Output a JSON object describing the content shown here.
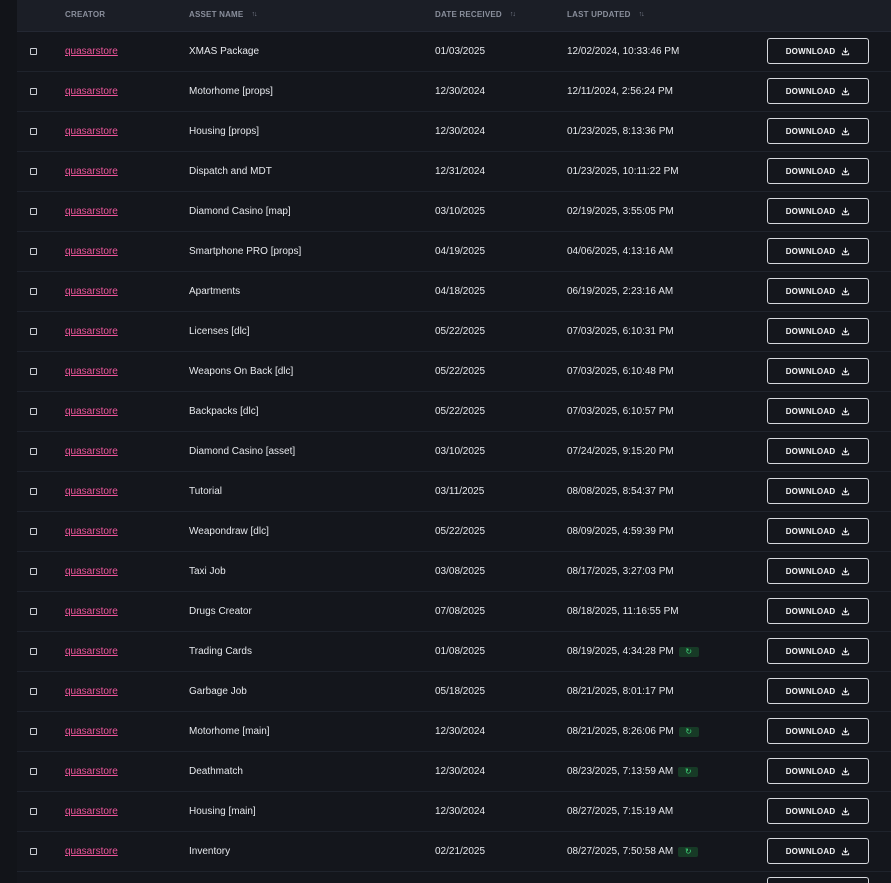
{
  "table": {
    "headers": {
      "creator": "CREATOR",
      "asset_name": "ASSET NAME",
      "date_received": "DATE RECEIVED",
      "last_updated": "LAST UPDATED"
    },
    "sort_icon": "sort-arrows-icon",
    "download_label": "DOWNLOAD",
    "download_icon": "download-icon",
    "update_badge_icon": "refresh-icon",
    "rows": [
      {
        "creator": "quasarstore",
        "asset": "XMAS Package",
        "received": "01/03/2025",
        "updated": "12/02/2024, 10:33:46 PM",
        "badge": false
      },
      {
        "creator": "quasarstore",
        "asset": "Motorhome [props]",
        "received": "12/30/2024",
        "updated": "12/11/2024, 2:56:24 PM",
        "badge": false
      },
      {
        "creator": "quasarstore",
        "asset": "Housing [props]",
        "received": "12/30/2024",
        "updated": "01/23/2025, 8:13:36 PM",
        "badge": false
      },
      {
        "creator": "quasarstore",
        "asset": "Dispatch and MDT",
        "received": "12/31/2024",
        "updated": "01/23/2025, 10:11:22 PM",
        "badge": false
      },
      {
        "creator": "quasarstore",
        "asset": "Diamond Casino [map]",
        "received": "03/10/2025",
        "updated": "02/19/2025, 3:55:05 PM",
        "badge": false
      },
      {
        "creator": "quasarstore",
        "asset": "Smartphone PRO [props]",
        "received": "04/19/2025",
        "updated": "04/06/2025, 4:13:16 AM",
        "badge": false
      },
      {
        "creator": "quasarstore",
        "asset": "Apartments",
        "received": "04/18/2025",
        "updated": "06/19/2025, 2:23:16 AM",
        "badge": false
      },
      {
        "creator": "quasarstore",
        "asset": "Licenses [dlc]",
        "received": "05/22/2025",
        "updated": "07/03/2025, 6:10:31 PM",
        "badge": false
      },
      {
        "creator": "quasarstore",
        "asset": "Weapons On Back [dlc]",
        "received": "05/22/2025",
        "updated": "07/03/2025, 6:10:48 PM",
        "badge": false
      },
      {
        "creator": "quasarstore",
        "asset": "Backpacks [dlc]",
        "received": "05/22/2025",
        "updated": "07/03/2025, 6:10:57 PM",
        "badge": false
      },
      {
        "creator": "quasarstore",
        "asset": "Diamond Casino [asset]",
        "received": "03/10/2025",
        "updated": "07/24/2025, 9:15:20 PM",
        "badge": false
      },
      {
        "creator": "quasarstore",
        "asset": "Tutorial",
        "received": "03/11/2025",
        "updated": "08/08/2025, 8:54:37 PM",
        "badge": false
      },
      {
        "creator": "quasarstore",
        "asset": "Weapondraw [dlc]",
        "received": "05/22/2025",
        "updated": "08/09/2025, 4:59:39 PM",
        "badge": false
      },
      {
        "creator": "quasarstore",
        "asset": "Taxi Job",
        "received": "03/08/2025",
        "updated": "08/17/2025, 3:27:03 PM",
        "badge": false
      },
      {
        "creator": "quasarstore",
        "asset": "Drugs Creator",
        "received": "07/08/2025",
        "updated": "08/18/2025, 11:16:55 PM",
        "badge": false
      },
      {
        "creator": "quasarstore",
        "asset": "Trading Cards",
        "received": "01/08/2025",
        "updated": "08/19/2025, 4:34:28 PM",
        "badge": true
      },
      {
        "creator": "quasarstore",
        "asset": "Garbage Job",
        "received": "05/18/2025",
        "updated": "08/21/2025, 8:01:17 PM",
        "badge": false
      },
      {
        "creator": "quasarstore",
        "asset": "Motorhome [main]",
        "received": "12/30/2024",
        "updated": "08/21/2025, 8:26:06 PM",
        "badge": true
      },
      {
        "creator": "quasarstore",
        "asset": "Deathmatch",
        "received": "12/30/2024",
        "updated": "08/23/2025, 7:13:59 AM",
        "badge": true
      },
      {
        "creator": "quasarstore",
        "asset": "Housing [main]",
        "received": "12/30/2024",
        "updated": "08/27/2025, 7:15:19 AM",
        "badge": false
      },
      {
        "creator": "quasarstore",
        "asset": "Inventory",
        "received": "02/21/2025",
        "updated": "08/27/2025, 7:50:58 AM",
        "badge": true
      }
    ]
  }
}
